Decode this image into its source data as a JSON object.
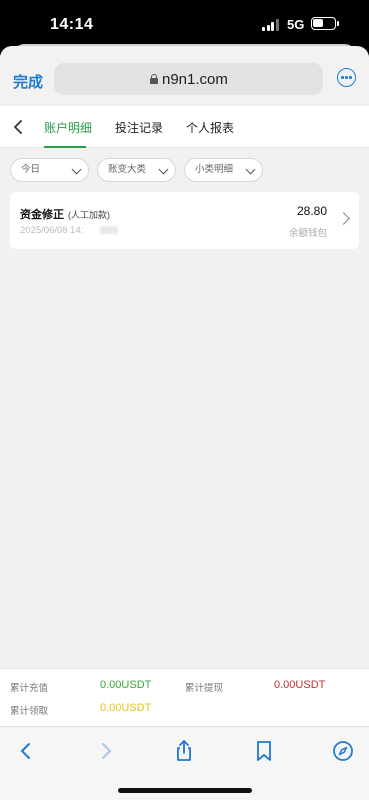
{
  "status_bar": {
    "time": "14:14",
    "network": "5G"
  },
  "browser": {
    "done_label": "完成",
    "url": "n9n1.com"
  },
  "tabs": [
    {
      "label": "账户明细",
      "active": true
    },
    {
      "label": "投注记录",
      "active": false
    },
    {
      "label": "个人报表",
      "active": false
    }
  ],
  "filters": [
    {
      "value": "今日"
    },
    {
      "value": "账变大类"
    },
    {
      "value": "小类明细"
    }
  ],
  "records": [
    {
      "title": "资金修正",
      "subtitle": "(人工加款)",
      "time": "2025/06/08 14:",
      "amount": "28.80",
      "wallet": "余额钱包"
    }
  ],
  "summary": {
    "deposit_label": "累计充值",
    "deposit_value": "0.00USDT",
    "withdraw_label": "累计提现",
    "withdraw_value": "0.00USDT",
    "claim_label": "累计领取",
    "claim_value": "0.00USDT"
  },
  "colors": {
    "accent_green": "#2a9d4a",
    "deposit": "#3aa63a",
    "withdraw": "#c0302e",
    "claim": "#e8c21a",
    "browser_blue": "#1f7ad1"
  },
  "toolbar_icons": [
    "back-arrow-icon",
    "forward-arrow-icon",
    "share-icon",
    "bookmarks-icon",
    "compass-icon"
  ]
}
